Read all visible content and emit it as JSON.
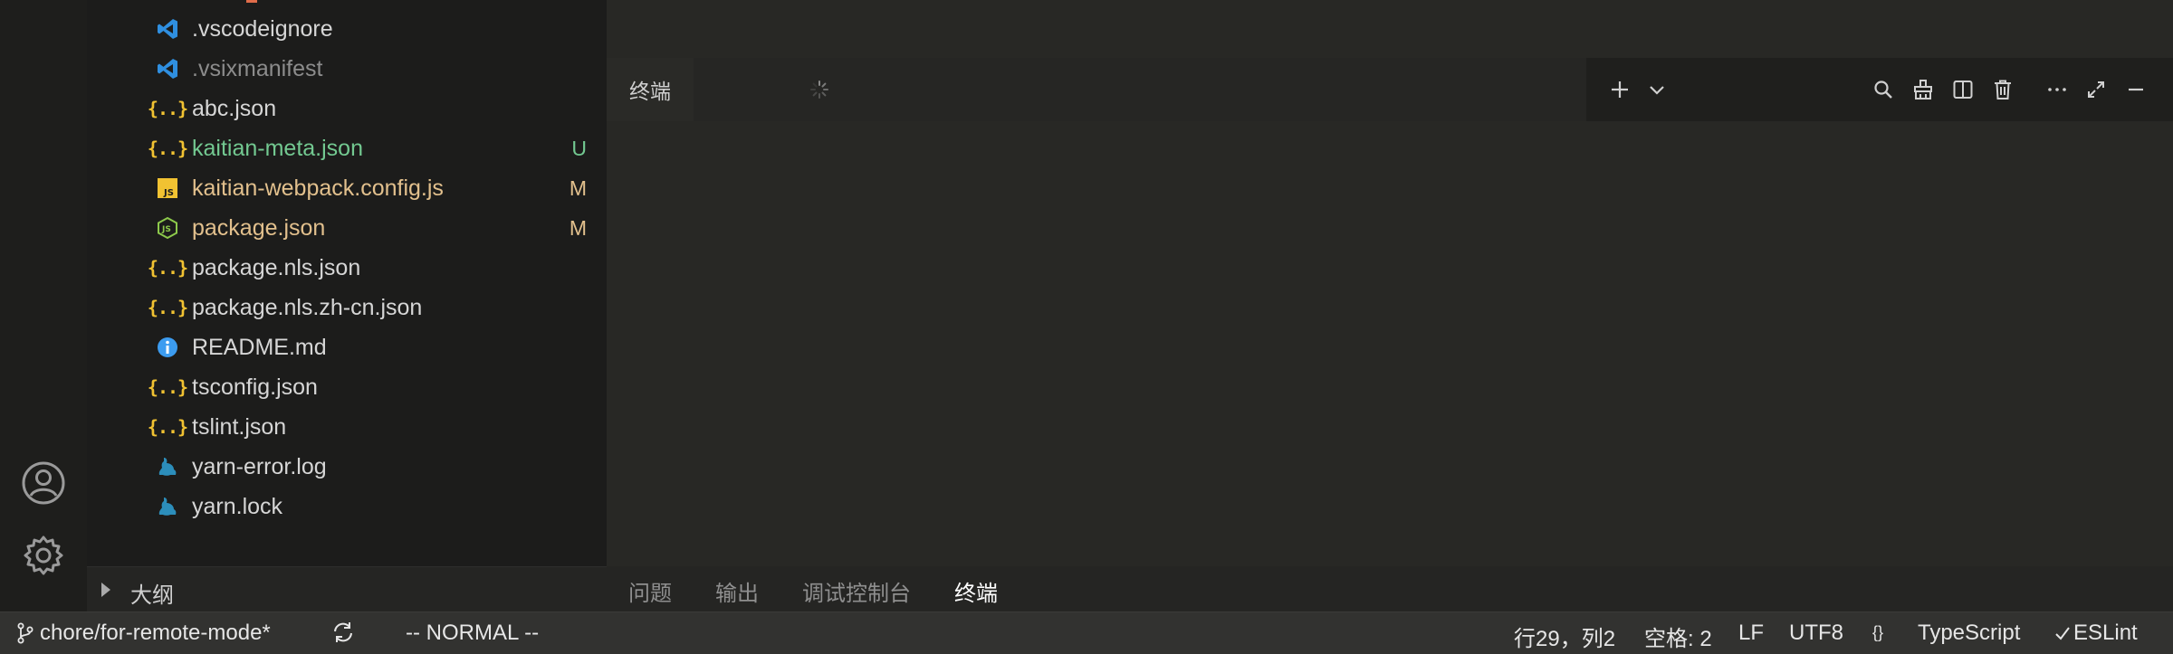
{
  "explorer": {
    "files": [
      {
        "name": ".vscodeignore",
        "icon": "vscode-icon",
        "color": "normal",
        "badge": ""
      },
      {
        "name": ".vsixmanifest",
        "icon": "vscode-icon",
        "color": "dim",
        "badge": ""
      },
      {
        "name": "abc.json",
        "icon": "json-icon",
        "color": "normal",
        "badge": ""
      },
      {
        "name": "kaitian-meta.json",
        "icon": "json-icon",
        "color": "added",
        "badge": "U"
      },
      {
        "name": "kaitian-webpack.config.js",
        "icon": "js-icon",
        "color": "mod",
        "badge": "M"
      },
      {
        "name": "package.json",
        "icon": "nodejs-icon",
        "color": "mod",
        "badge": "M"
      },
      {
        "name": "package.nls.json",
        "icon": "json-icon",
        "color": "normal",
        "badge": ""
      },
      {
        "name": "package.nls.zh-cn.json",
        "icon": "json-icon",
        "color": "normal",
        "badge": ""
      },
      {
        "name": "README.md",
        "icon": "info-icon",
        "color": "normal",
        "badge": ""
      },
      {
        "name": "tsconfig.json",
        "icon": "json-icon",
        "color": "normal",
        "badge": ""
      },
      {
        "name": "tslint.json",
        "icon": "json-icon",
        "color": "normal",
        "badge": ""
      },
      {
        "name": "yarn-error.log",
        "icon": "yarn-icon",
        "color": "normal",
        "badge": ""
      },
      {
        "name": "yarn.lock",
        "icon": "yarn-icon",
        "color": "normal",
        "badge": ""
      }
    ],
    "outline_label": "大纲"
  },
  "terminal": {
    "tab_label": "终端"
  },
  "panel": {
    "tabs": [
      "问题",
      "输出",
      "调试控制台",
      "终端"
    ],
    "active_tab": "终端"
  },
  "status_bar": {
    "branch": "chore/for-remote-mode*",
    "vim_mode": "-- NORMAL --",
    "cursor": "行29，列2",
    "indent": "空格: 2",
    "eol": "LF",
    "encoding": "UTF8",
    "braces": "{}",
    "language": "TypeScript",
    "linter": "ESLint"
  },
  "colors": {
    "normal": "#d6d6d6",
    "dim": "#8c8c8c",
    "added": "#73c991",
    "modified": "#e2c08d",
    "json_icon": "#f1c232",
    "vscode_icon": "#2f8fe0",
    "info_icon": "#3c9cf0",
    "yarn_icon": "#2c8ebb",
    "node_icon": "#8cc84b"
  }
}
